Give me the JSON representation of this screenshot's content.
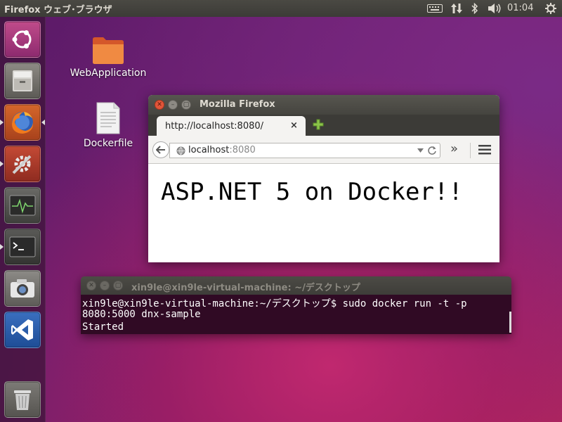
{
  "top_panel": {
    "app_title": "Firefox ウェブ･ブラウザ",
    "clock": "01:04",
    "tray_icons": [
      "keyboard-icon",
      "network-transfer-icon",
      "bluetooth-icon",
      "volume-icon",
      "power-gear-icon"
    ]
  },
  "launcher": {
    "items": [
      "ubuntu-dash-icon",
      "files-icon",
      "firefox-icon",
      "system-settings-icon",
      "system-monitor-icon",
      "terminal-icon",
      "camera-icon",
      "visual-studio-code-icon",
      "trash-icon"
    ]
  },
  "desktop": {
    "icons": [
      {
        "label": "WebApplication",
        "type": "folder-icon"
      },
      {
        "label": "Dockerfile",
        "type": "text-file-icon"
      }
    ]
  },
  "firefox": {
    "window_title": "Mozilla Firefox",
    "tab_label": "http://localhost:8080/",
    "tab_close": "×",
    "url_host": "localhost",
    "url_port": ":8080",
    "overflow_chevron": "»",
    "page_heading": "ASP.NET 5 on Docker!!"
  },
  "terminal": {
    "window_title": "xin9le@xin9le-virtual-machine: ~/デスクトップ",
    "lines": [
      "xin9le@xin9le-virtual-machine:~/デスクトップ$ sudo docker run -t -p",
      "8080:5000 dnx-sample",
      "Started"
    ]
  },
  "colors": {
    "panel": "#3c3b37",
    "terminal_bg": "#300a24",
    "close_button": "#e2553a"
  }
}
